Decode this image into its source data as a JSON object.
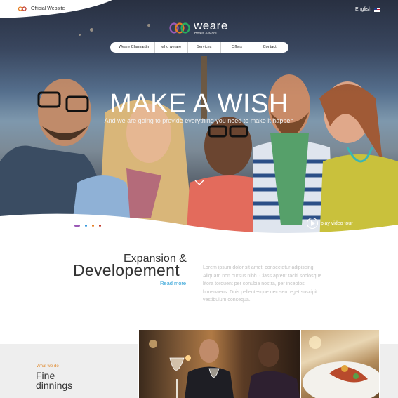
{
  "header": {
    "official_label": "Official Website",
    "language_label": "English"
  },
  "logo": {
    "name": "weare",
    "tagline": "Hotels & More"
  },
  "nav": {
    "items": [
      {
        "label": "Weare Chamartín"
      },
      {
        "label": "who we are"
      },
      {
        "label": "Services"
      },
      {
        "label": "Offers"
      },
      {
        "label": "Contact"
      }
    ]
  },
  "hero": {
    "headline": "MAKE A WISH",
    "subline": "And we are going to provide everything you need to make it happen",
    "play_label": "play video tour",
    "slide_dots": [
      {
        "color": "#9b59b6"
      },
      {
        "color": "#3498db"
      },
      {
        "color": "#e67e22"
      },
      {
        "color": "#c0392b"
      }
    ]
  },
  "expansion": {
    "title_line1": "Expansion &",
    "title_line2": "Developement",
    "read_more": "Read more",
    "body": "Lorem ipsum dolor sit amet, consectetur adipiscing. Aliquam non cursus nibh. Class aptent taciti sociosque litora torquent per conubia nostra, per inceptos himenaeos. Duis pellentesque nec sem eget suscipit vestibulum consequa."
  },
  "what_we_do": {
    "label": "What we do",
    "title_line1": "Fine",
    "title_line2": "dinnings"
  },
  "colors": {
    "accent_blue": "#2a9fd6",
    "accent_orange": "#e08a2e",
    "text_dark": "#333333"
  }
}
